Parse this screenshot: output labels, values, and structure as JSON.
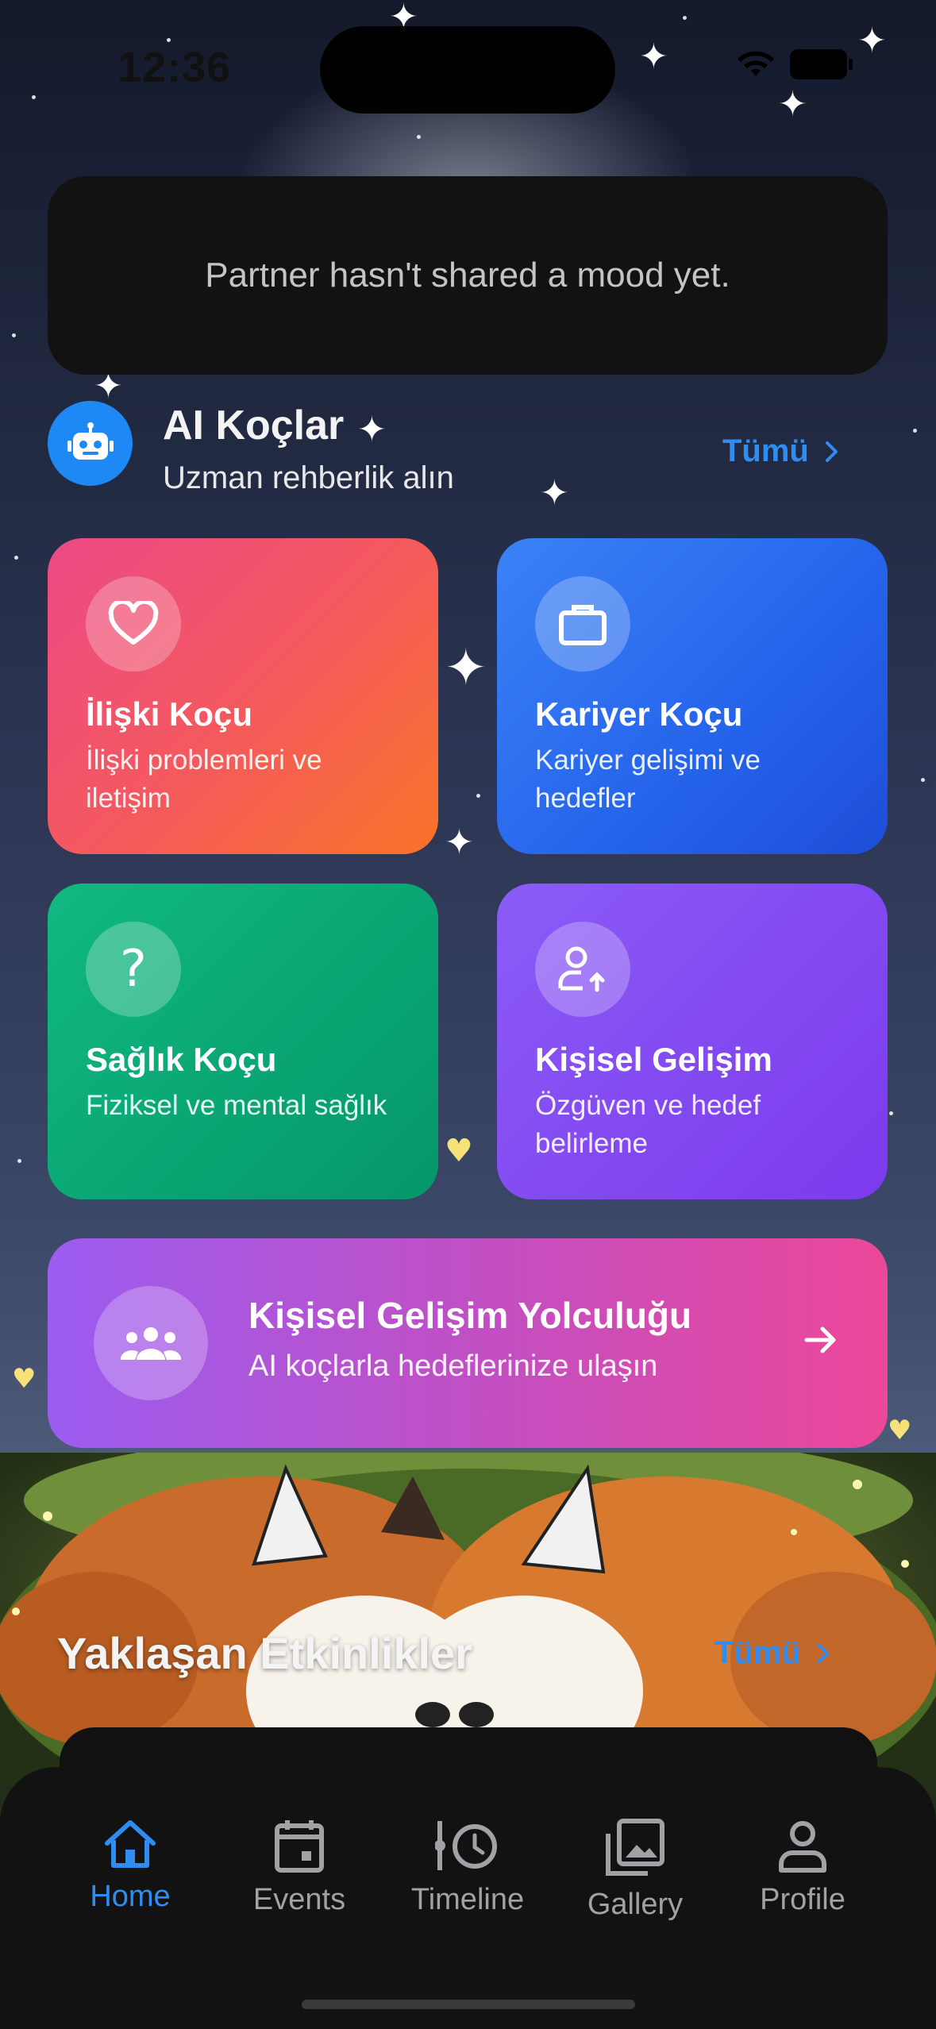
{
  "status_bar": {
    "time": "12:36"
  },
  "mood_card": {
    "text": "Partner hasn't shared a mood yet."
  },
  "ai_coaches": {
    "title": "AI Koçlar",
    "subtitle": "Uzman rehberlik alın",
    "see_all": "Tümü",
    "icon": "robot-icon",
    "cards": [
      {
        "title": "İlişki Koçu",
        "description": "İlişki problemleri ve iletişim",
        "icon": "heart-icon"
      },
      {
        "title": "Kariyer Koçu",
        "description": "Kariyer gelişimi ve hedefler",
        "icon": "briefcase-icon"
      },
      {
        "title": "Sağlık Koçu",
        "description": "Fiziksel ve mental sağlık",
        "icon": "question-icon"
      },
      {
        "title": "Kişisel Gelişim",
        "description": "Özgüven ve hedef belirleme",
        "icon": "person-up-icon"
      }
    ]
  },
  "journey": {
    "title": "Kişisel Gelişim Yolculuğu",
    "subtitle": "AI koçlarla hedeflerinize ulaşın",
    "icon": "group-icon"
  },
  "events": {
    "title": "Yaklaşan Etkinlikler",
    "see_all": "Tümü"
  },
  "tab_bar": {
    "items": [
      {
        "label": "Home",
        "icon": "home-icon",
        "active": true
      },
      {
        "label": "Events",
        "icon": "calendar-icon",
        "active": false
      },
      {
        "label": "Timeline",
        "icon": "history-icon",
        "active": false
      },
      {
        "label": "Gallery",
        "icon": "gallery-icon",
        "active": false
      },
      {
        "label": "Profile",
        "icon": "person-icon",
        "active": false
      }
    ]
  },
  "colors": {
    "accent": "#2e8cf2",
    "card_bg": "#121212"
  }
}
